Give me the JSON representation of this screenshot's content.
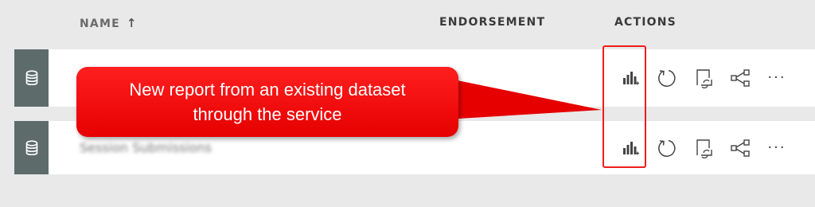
{
  "columns": {
    "name": "NAME",
    "name_sort_icon": "arrow-up-icon",
    "endorsement": "ENDORSEMENT",
    "actions": "ACTIONS"
  },
  "rows": [
    {
      "icon": "database-icon",
      "name": "",
      "actions": [
        "create-report-icon",
        "refresh-icon",
        "schedule-refresh-icon",
        "share-icon",
        "more-options-icon"
      ],
      "more_label": "···"
    },
    {
      "icon": "database-icon",
      "name": "Session Submissions",
      "actions": [
        "create-report-icon",
        "refresh-icon",
        "schedule-refresh-icon",
        "share-icon",
        "more-options-icon"
      ],
      "more_label": "···"
    }
  ],
  "callout": {
    "line1": "New report from an existing dataset",
    "line2": "through the service"
  },
  "colors": {
    "callout_red": "#e60000",
    "highlight_border": "#ee1c1c",
    "icon_cell": "#5e6b6b",
    "page_background": "#e9e9e9"
  }
}
